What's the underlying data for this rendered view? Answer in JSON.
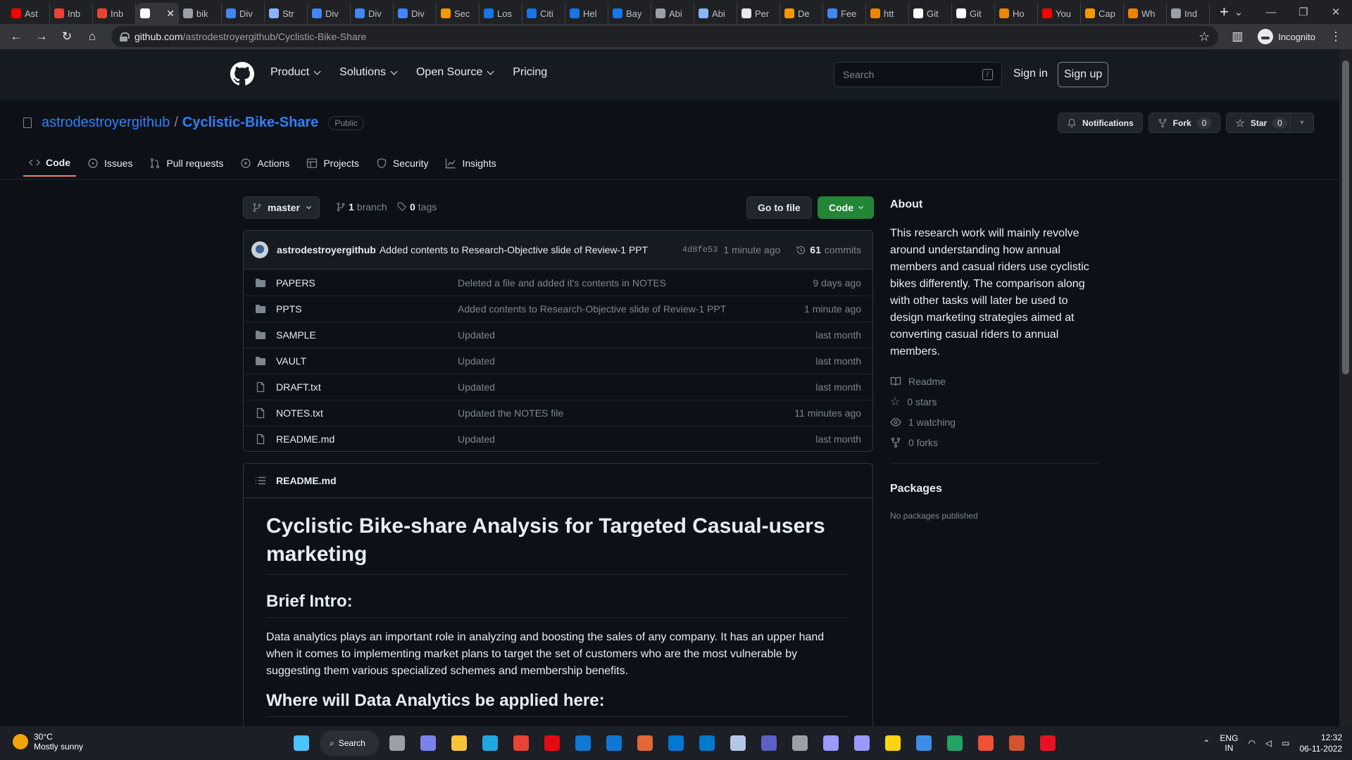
{
  "browser": {
    "tabs": [
      {
        "label": "Ast",
        "color": "#ff0000"
      },
      {
        "label": "Inb",
        "color": "#ea4335"
      },
      {
        "label": "Inb",
        "color": "#ea4335"
      },
      {
        "label": "",
        "color": "#ffffff",
        "active": true
      },
      {
        "label": "bik",
        "color": "#9aa0a6"
      },
      {
        "label": "Div",
        "color": "#4285f4"
      },
      {
        "label": "Str",
        "color": "#8ab4f8"
      },
      {
        "label": "Div",
        "color": "#4285f4"
      },
      {
        "label": "Div",
        "color": "#4285f4"
      },
      {
        "label": "Div",
        "color": "#4285f4"
      },
      {
        "label": "Sec",
        "color": "#f29900"
      },
      {
        "label": "Los",
        "color": "#1a73e8"
      },
      {
        "label": "Citi",
        "color": "#1a73e8"
      },
      {
        "label": "Hel",
        "color": "#1a73e8"
      },
      {
        "label": "Bay",
        "color": "#1a73e8"
      },
      {
        "label": "Abi",
        "color": "#9aa0a6"
      },
      {
        "label": "Abi",
        "color": "#8ab4f8"
      },
      {
        "label": "Per",
        "color": "#e8eaed"
      },
      {
        "label": "De",
        "color": "#f29900"
      },
      {
        "label": "Fee",
        "color": "#4285f4"
      },
      {
        "label": "htt",
        "color": "#ea8600"
      },
      {
        "label": "Git",
        "color": "#ffffff"
      },
      {
        "label": "Git",
        "color": "#ffffff"
      },
      {
        "label": "Ho",
        "color": "#ea8600"
      },
      {
        "label": "You",
        "color": "#ff0000"
      },
      {
        "label": "Cap",
        "color": "#f29900"
      },
      {
        "label": "Wh",
        "color": "#ea8600"
      },
      {
        "label": "Ind",
        "color": "#9aa0a6"
      }
    ],
    "url_host": "github.com",
    "url_path": "/astrodestroyergithub/Cyclistic-Bike-Share",
    "profile_label": "Incognito"
  },
  "gh_header": {
    "nav": [
      "Product",
      "Solutions",
      "Open Source",
      "Pricing"
    ],
    "search_placeholder": "Search",
    "search_key": "/",
    "sign_in": "Sign in",
    "sign_up": "Sign up"
  },
  "repo": {
    "owner": "astrodestroyergithub",
    "separator": "/",
    "name": "Cyclistic-Bike-Share",
    "visibility": "Public",
    "notifications_label": "Notifications",
    "fork_label": "Fork",
    "fork_count": "0",
    "star_label": "Star",
    "star_count": "0",
    "tabs": [
      "Code",
      "Issues",
      "Pull requests",
      "Actions",
      "Projects",
      "Security",
      "Insights"
    ]
  },
  "browser_bar": {
    "branch": "master",
    "branch_count": "1",
    "branch_label": "branch",
    "tag_count": "0",
    "tag_label": "tags",
    "goto_file": "Go to file",
    "code_button": "Code"
  },
  "latest_commit": {
    "author": "astrodestroyergithub",
    "message": "Added contents to Research-Objective slide of Review-1 PPT",
    "sha": "4d8fe53",
    "time": "1 minute ago",
    "commit_count": "61",
    "commit_label": "commits"
  },
  "files": [
    {
      "name": "PAPERS",
      "type": "dir",
      "message": "Deleted a file and added it's contents in NOTES",
      "date": "9 days ago"
    },
    {
      "name": "PPTS",
      "type": "dir",
      "message": "Added contents to Research-Objective slide of Review-1 PPT",
      "date": "1 minute ago"
    },
    {
      "name": "SAMPLE",
      "type": "dir",
      "message": "Updated",
      "date": "last month"
    },
    {
      "name": "VAULT",
      "type": "dir",
      "message": "Updated",
      "date": "last month"
    },
    {
      "name": "DRAFT.txt",
      "type": "file",
      "message": "Updated",
      "date": "last month"
    },
    {
      "name": "NOTES.txt",
      "type": "file",
      "message": "Updated the NOTES file",
      "date": "11 minutes ago"
    },
    {
      "name": "README.md",
      "type": "file",
      "message": "Updated",
      "date": "last month"
    }
  ],
  "readme": {
    "filename": "README.md",
    "title": "Cyclistic Bike-share Analysis for Targeted Casual-users marketing",
    "h2_intro": "Brief Intro:",
    "intro_text": "Data analytics plays an important role in analyzing and boosting the sales of any company. It has an upper hand when it comes to implementing market plans to target the set of customers who are the most vulnerable by suggesting them various specialized schemes and membership benefits.",
    "h2_where": "Where will Data Analytics be applied here:"
  },
  "about": {
    "title": "About",
    "description": "This research work will mainly revolve around understanding how annual members and casual riders use cyclistic bikes differently. The comparison along with other tasks will later be used to design marketing strategies aimed at converting casual riders to annual members.",
    "readme": "Readme",
    "stars": "0 stars",
    "watching": "1 watching",
    "forks": "0 forks",
    "packages_title": "Packages",
    "packages_text": "No packages published"
  },
  "taskbar": {
    "temperature": "30°C",
    "weather": "Mostly sunny",
    "search_label": "Search",
    "apps": [
      {
        "name": "start",
        "color": "#4cc2ff"
      },
      {
        "name": "task-view",
        "color": "#9aa0a6"
      },
      {
        "name": "chat",
        "color": "#7b83eb"
      },
      {
        "name": "file-explorer",
        "color": "#f8c33b"
      },
      {
        "name": "edge",
        "color": "#1fa8e0"
      },
      {
        "name": "chrome",
        "color": "#ea4335"
      },
      {
        "name": "netflix",
        "color": "#e50914"
      },
      {
        "name": "mail",
        "color": "#0f78d4"
      },
      {
        "name": "store",
        "color": "#0f78d4"
      },
      {
        "name": "matlab",
        "color": "#e16737"
      },
      {
        "name": "app-blue",
        "color": "#0078d4"
      },
      {
        "name": "vscode",
        "color": "#007acc"
      },
      {
        "name": "virtualbox",
        "color": "#b4c7e7"
      },
      {
        "name": "teams",
        "color": "#5b5fc7"
      },
      {
        "name": "obs",
        "color": "#9aa0a6"
      },
      {
        "name": "premiere",
        "color": "#9999ff"
      },
      {
        "name": "after-effects",
        "color": "#9999ff"
      },
      {
        "name": "sticky-notes",
        "color": "#ffd50f"
      },
      {
        "name": "notepad",
        "color": "#3b8ee8"
      },
      {
        "name": "excel",
        "color": "#21a366"
      },
      {
        "name": "git",
        "color": "#f05033"
      },
      {
        "name": "powerpoint",
        "color": "#d35230"
      },
      {
        "name": "snipping",
        "color": "#e81123"
      }
    ],
    "lang_top": "ENG",
    "lang_bottom": "IN",
    "time": "12:32",
    "date": "06-11-2022"
  }
}
